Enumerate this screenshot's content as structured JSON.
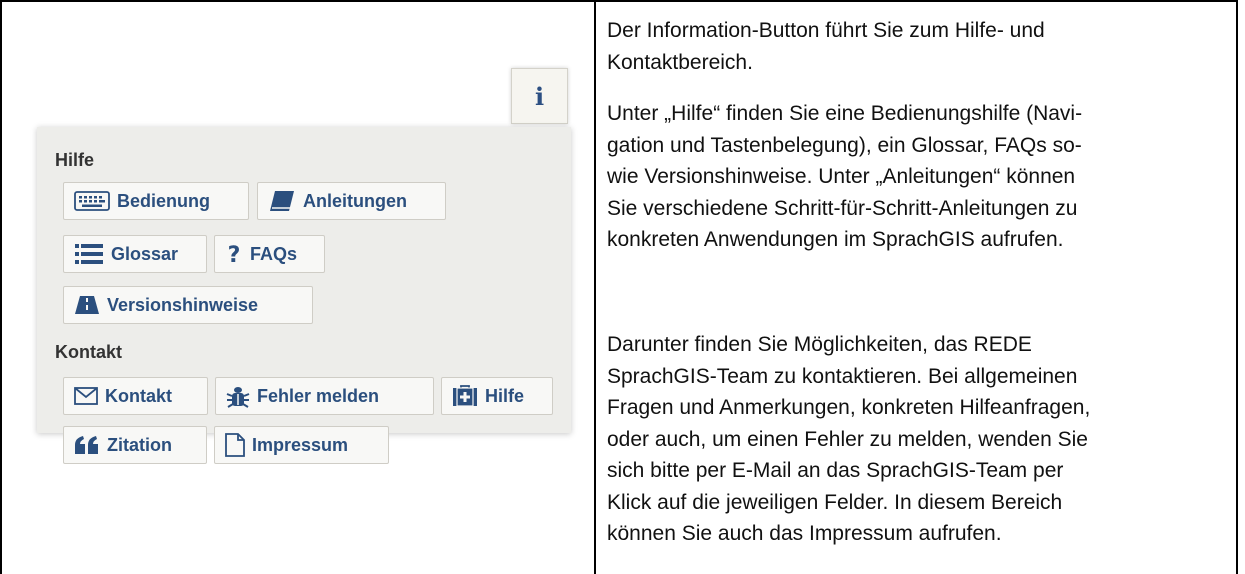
{
  "info_button": {
    "glyph": "i"
  },
  "panel": {
    "help_section": {
      "title": "Hilfe",
      "buttons": [
        "Bedienung",
        "Anleitungen",
        "Glossar",
        "FAQs",
        "Versionshinweise"
      ]
    },
    "contact_section": {
      "title": "Kontakt",
      "buttons": [
        "Kontakt",
        "Fehler melden",
        "Hilfe",
        "Zitation",
        "Impressum"
      ]
    }
  },
  "text": {
    "p1_lines": [
      "Der Information-Button führt Sie zum Hilfe- und",
      "Kontaktbereich."
    ],
    "p2_lines": [
      "Unter „Hilfe“ finden Sie eine Bedienungshilfe (Navi-",
      "gation und Tastenbelegung), ein Glossar, FAQs so-",
      "wie Versionshinweise. Unter „Anleitungen“ können",
      "Sie verschiedene Schritt-für-Schritt-Anleitungen zu",
      "konkreten Anwendungen im SprachGIS aufrufen."
    ],
    "p3_lines": [
      "Darunter finden Sie Möglichkeiten, das REDE",
      "SprachGIS-Team zu kontaktieren. Bei allgemeinen",
      "Fragen und Anmerkungen, konkreten Hilfeanfragen,",
      "oder auch, um einen Fehler zu melden, wenden Sie",
      "sich bitte per E-Mail an das SprachGIS-Team per",
      "Klick auf die jeweiligen Felder. In diesem Bereich",
      "können Sie auch das Impressum aufrufen."
    ]
  },
  "colors": {
    "accent": "#2b4f7e",
    "panel_bg": "#ededea",
    "button_bg": "#f8f8f6"
  }
}
